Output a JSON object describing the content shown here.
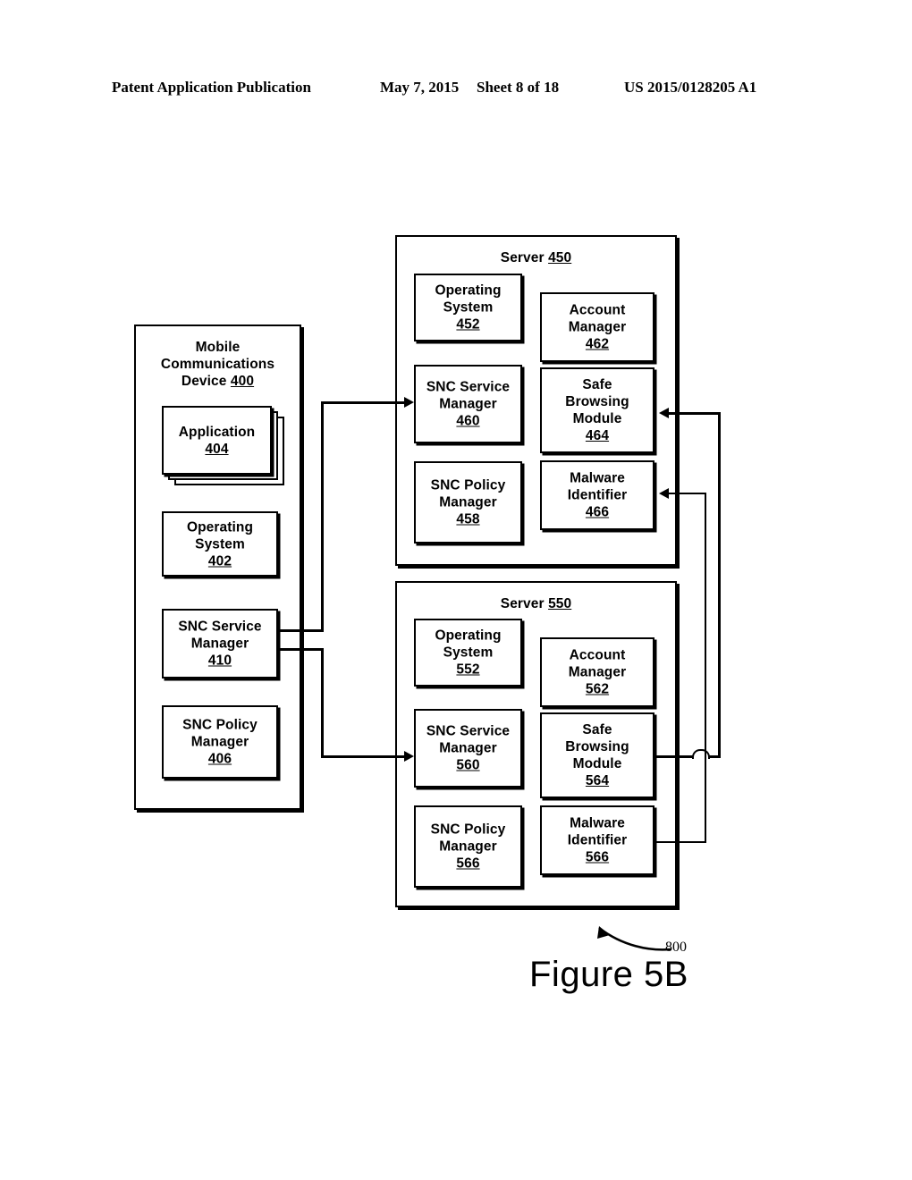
{
  "header": {
    "publication": "Patent Application Publication",
    "date": "May 7, 2015",
    "sheet": "Sheet 8 of 18",
    "patent_number": "US 2015/0128205 A1"
  },
  "figure": {
    "caption": "Figure 5B",
    "reference_numeral": "800"
  },
  "device": {
    "title_line1": "Mobile",
    "title_line2": "Communications",
    "title_line3": "Device",
    "ref": "400",
    "components": [
      {
        "line1": "Application",
        "line2": "",
        "line3": "",
        "ref": "404"
      },
      {
        "line1": "Operating",
        "line2": "System",
        "line3": "",
        "ref": "402"
      },
      {
        "line1": "SNC Service",
        "line2": "Manager",
        "line3": "",
        "ref": "410"
      },
      {
        "line1": "SNC Policy",
        "line2": "Manager",
        "line3": "",
        "ref": "406"
      }
    ]
  },
  "servers": [
    {
      "title": "Server",
      "ref": "450",
      "left_column": [
        {
          "line1": "Operating",
          "line2": "System",
          "line3": "",
          "ref": "452"
        },
        {
          "line1": "SNC Service",
          "line2": "Manager",
          "line3": "",
          "ref": "460"
        },
        {
          "line1": "SNC Policy",
          "line2": "Manager",
          "line3": "",
          "ref": "458"
        }
      ],
      "right_column": [
        {
          "line1": "Account",
          "line2": "Manager",
          "line3": "",
          "ref": "462"
        },
        {
          "line1": "Safe",
          "line2": "Browsing",
          "line3": "Module",
          "ref": "464"
        },
        {
          "line1": "Malware",
          "line2": "Identifier",
          "line3": "",
          "ref": "466"
        }
      ]
    },
    {
      "title": "Server",
      "ref": "550",
      "left_column": [
        {
          "line1": "Operating",
          "line2": "System",
          "line3": "",
          "ref": "552"
        },
        {
          "line1": "SNC Service",
          "line2": "Manager",
          "line3": "",
          "ref": "560"
        },
        {
          "line1": "SNC Policy",
          "line2": "Manager",
          "line3": "",
          "ref": "566"
        }
      ],
      "right_column": [
        {
          "line1": "Account",
          "line2": "Manager",
          "line3": "",
          "ref": "562"
        },
        {
          "line1": "Safe",
          "line2": "Browsing",
          "line3": "Module",
          "ref": "564"
        },
        {
          "line1": "Malware",
          "line2": "Identifier",
          "line3": "",
          "ref": "566"
        }
      ]
    }
  ]
}
